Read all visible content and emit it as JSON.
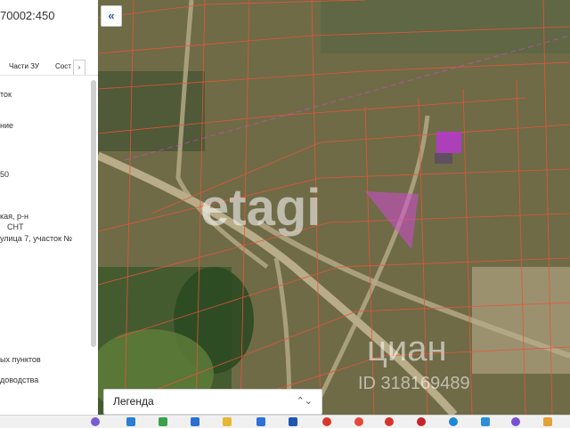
{
  "sidebar": {
    "title": "70002:450",
    "tabs": [
      "Части ЗУ",
      "Сост"
    ],
    "tab_scroll_label": "›",
    "fragments": [
      "ток",
      "ние",
      "50",
      "кая, р-н",
      "СНТ",
      "улица 7, участок №",
      "ых пунктов",
      "доводства"
    ]
  },
  "map": {
    "collapse_label": "«",
    "legend_label": "Легенда",
    "legend_chevron": "⌃⌄",
    "watermark_etagi": "etagi",
    "watermark_cian": "циан",
    "watermark_id": "ID 318169489",
    "highlight_color": "#d24bd2",
    "parcel_color": "#e8553a"
  },
  "taskbar": {
    "icons": [
      "browser-icon",
      "app-icon",
      "store-icon",
      "mail-icon",
      "files-icon",
      "chrome-icon",
      "word-icon",
      "settings-icon",
      "media-icon",
      "yandex-icon",
      "opera-icon",
      "edge-icon",
      "photos-icon",
      "viber-icon",
      "folder-icon"
    ]
  }
}
